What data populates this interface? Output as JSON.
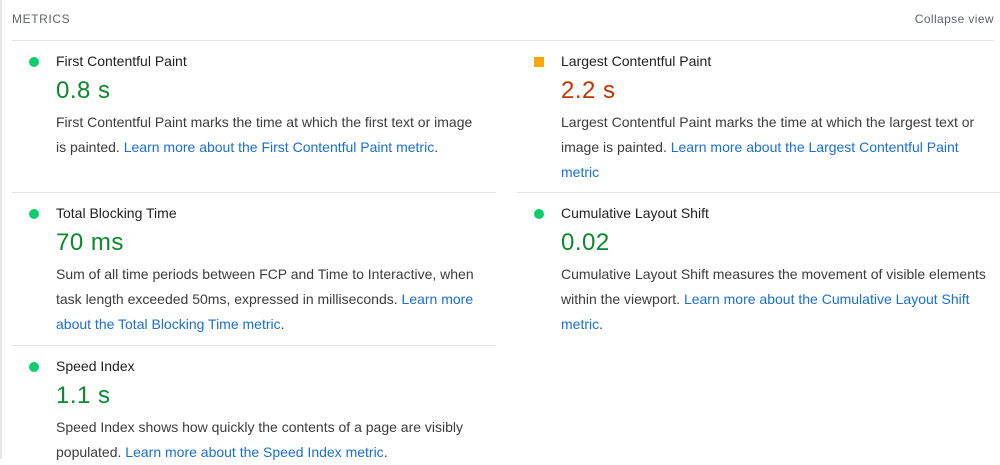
{
  "header": {
    "title": "METRICS",
    "collapse_label": "Collapse view"
  },
  "metrics": [
    {
      "title": "First Contentful Paint",
      "value": "0.8 s",
      "status": "pass",
      "status_color": "#0cce6b",
      "description": "First Contentful Paint marks the time at which the first text or image is painted.",
      "link": "Learn more about the First Contentful Paint metric",
      "trail": "."
    },
    {
      "title": "Largest Contentful Paint",
      "value": "2.2 s",
      "status": "average",
      "status_color": "#ffa400",
      "description": "Largest Contentful Paint marks the time at which the largest text or image is painted.",
      "link": "Learn more about the Largest Contentful Paint metric",
      "trail": ""
    },
    {
      "title": "Total Blocking Time",
      "value": "70 ms",
      "status": "pass",
      "status_color": "#0cce6b",
      "description": "Sum of all time periods between FCP and Time to Interactive, when task length exceeded 50ms, expressed in milliseconds.",
      "link": "Learn more about the Total Blocking Time metric",
      "trail": "."
    },
    {
      "title": "Cumulative Layout Shift",
      "value": "0.02",
      "status": "pass",
      "status_color": "#0cce6b",
      "description": "Cumulative Layout Shift measures the movement of visible elements within the viewport.",
      "link": "Learn more about the Cumulative Layout Shift metric",
      "trail": "."
    },
    {
      "title": "Speed Index",
      "value": "1.1 s",
      "status": "pass",
      "status_color": "#0cce6b",
      "description": "Speed Index shows how quickly the contents of a page are visibly populated.",
      "link": "Learn more about the Speed Index metric",
      "trail": "."
    }
  ]
}
